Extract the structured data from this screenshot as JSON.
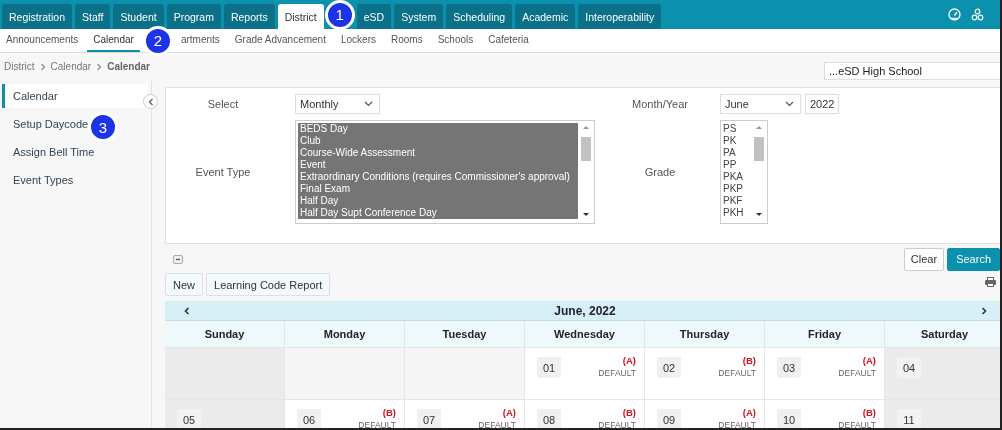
{
  "top_tabs": [
    {
      "label": "Registration",
      "selected": false
    },
    {
      "label": "Staff",
      "selected": false
    },
    {
      "label": "Student",
      "selected": false
    },
    {
      "label": "Program",
      "selected": false
    },
    {
      "label": "Reports",
      "selected": false
    },
    {
      "label": "District",
      "selected": true
    },
    {
      "label": "eSD",
      "selected": false
    },
    {
      "label": "System",
      "selected": false
    },
    {
      "label": "Scheduling",
      "selected": false
    },
    {
      "label": "Academic",
      "selected": false
    },
    {
      "label": "Interoperability",
      "selected": false
    }
  ],
  "sub_tabs": [
    {
      "label": "Announcements",
      "selected": false
    },
    {
      "label": "Calendar",
      "selected": true
    },
    {
      "label": "artments",
      "selected": false
    },
    {
      "label": "Grade Advancement",
      "selected": false
    },
    {
      "label": "Lockers",
      "selected": false
    },
    {
      "label": "Rooms",
      "selected": false
    },
    {
      "label": "Schools",
      "selected": false
    },
    {
      "label": "Cafeteria",
      "selected": false
    }
  ],
  "breadcrumb": [
    "District",
    "Calendar",
    "Calendar"
  ],
  "school_select": {
    "value": "...eSD High School"
  },
  "sidebar": {
    "items": [
      {
        "label": "Calendar",
        "selected": true
      },
      {
        "label": "Setup Daycode",
        "selected": false
      },
      {
        "label": "Assign Bell Time",
        "selected": false
      },
      {
        "label": "Event Types",
        "selected": false
      }
    ]
  },
  "filters": {
    "select": {
      "label": "Select",
      "value": "Monthly"
    },
    "event_type": {
      "label": "Event Type",
      "options": [
        {
          "label": "BEDS Day",
          "selected": true
        },
        {
          "label": "Club",
          "selected": true
        },
        {
          "label": "Course-Wide Assessment",
          "selected": true
        },
        {
          "label": "Event",
          "selected": true
        },
        {
          "label": "Extraordinary Conditions (requires Commissioner's approval)",
          "selected": true
        },
        {
          "label": "Final Exam",
          "selected": true
        },
        {
          "label": "Half Day",
          "selected": true
        },
        {
          "label": "Half Day Supt Conference Day",
          "selected": true
        }
      ]
    },
    "month_year": {
      "label": "Month/Year",
      "month": "June",
      "year": "2022"
    },
    "grade": {
      "label": "Grade",
      "options": [
        {
          "label": "PS",
          "selected": false
        },
        {
          "label": "PK",
          "selected": false
        },
        {
          "label": "PA",
          "selected": false
        },
        {
          "label": "PP",
          "selected": false
        },
        {
          "label": "PKA",
          "selected": false
        },
        {
          "label": "PKP",
          "selected": false
        },
        {
          "label": "PKF",
          "selected": false
        },
        {
          "label": "PKH",
          "selected": false
        }
      ]
    }
  },
  "actions": {
    "clear": "Clear",
    "search": "Search"
  },
  "toolbar": [
    "New",
    "Learning Code Report"
  ],
  "calendar": {
    "title": "June, 2022",
    "weekdays": [
      "Sunday",
      "Monday",
      "Tuesday",
      "Wednesday",
      "Thursday",
      "Friday",
      "Saturday"
    ],
    "weeks": [
      [
        {
          "kind": "weekend"
        },
        {
          "kind": "empty"
        },
        {
          "kind": "empty"
        },
        {
          "kind": "day",
          "date": "01",
          "rotation": "(A)",
          "daycode": "DEFAULT"
        },
        {
          "kind": "day",
          "date": "02",
          "rotation": "(B)",
          "daycode": "DEFAULT"
        },
        {
          "kind": "day",
          "date": "03",
          "rotation": "(A)",
          "daycode": "DEFAULT"
        },
        {
          "kind": "weekend",
          "date": "04"
        }
      ],
      [
        {
          "kind": "weekend",
          "date": "05"
        },
        {
          "kind": "day",
          "date": "06",
          "rotation": "(B)",
          "daycode": "DEFAULT"
        },
        {
          "kind": "day",
          "date": "07",
          "rotation": "(A)",
          "daycode": "DEFAULT"
        },
        {
          "kind": "day",
          "date": "08",
          "rotation": "(B)",
          "daycode": "DEFAULT"
        },
        {
          "kind": "day",
          "date": "09",
          "rotation": "(A)",
          "daycode": "DEFAULT"
        },
        {
          "kind": "day",
          "date": "10",
          "rotation": "(B)",
          "daycode": "DEFAULT"
        },
        {
          "kind": "weekend",
          "date": "11"
        }
      ]
    ]
  },
  "callouts": [
    "1",
    "2",
    "3"
  ]
}
